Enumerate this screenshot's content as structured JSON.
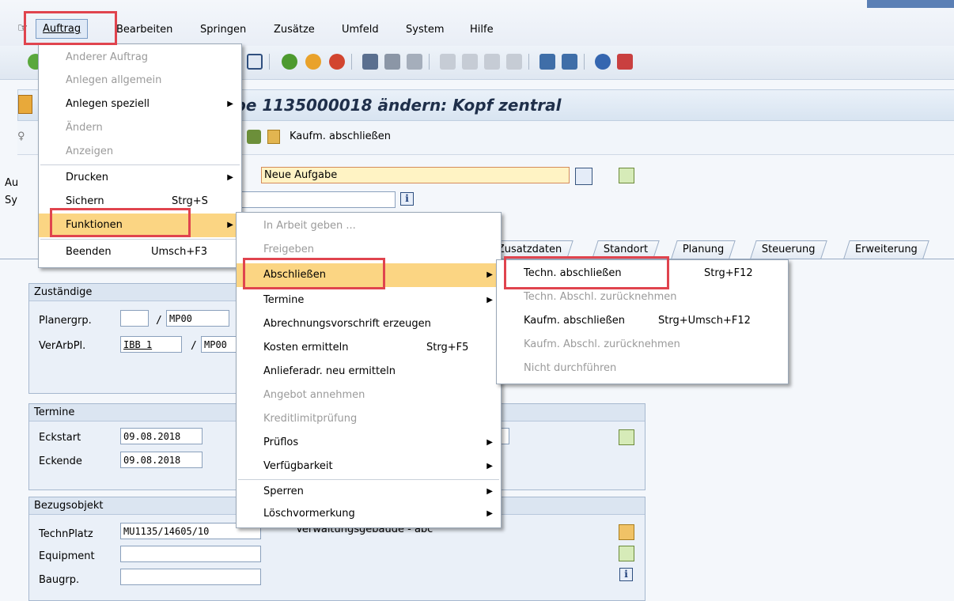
{
  "menubar": {
    "items": [
      "Auftrag",
      "Bearbeiten",
      "Springen",
      "Zusätze",
      "Umfeld",
      "System",
      "Hilfe"
    ]
  },
  "title": "abe 1135000018 ändern: Kopf zentral",
  "app_toolbar": {
    "kaufm_label": "Kaufm. abschließen"
  },
  "header_field": {
    "value": "Neue Aufgabe"
  },
  "tabs": [
    "Zusatzdaten",
    "Standort",
    "Planung",
    "Steuerung",
    "Erweiterung"
  ],
  "groups": {
    "zustaendige": {
      "title": "Zuständige",
      "planergrp_label": "Planergrp.",
      "planergrp_value": "MP00",
      "verarbpl_label": "VerArbPl.",
      "verarbpl_value": "IBB 1",
      "verarbpl_plant": "MP00"
    },
    "termine": {
      "title": "Termine",
      "eckstart_label": "Eckstart",
      "eckstart_value": "09.08.2018",
      "eckende_label": "Eckende",
      "eckende_value": "09.08.2018"
    },
    "bezugsobjekt": {
      "title": "Bezugsobjekt",
      "technplatz_label": "TechnPlatz",
      "technplatz_value": "MU1135/14605/10",
      "technplatz_desc": "Verwaltungsgebäude - abc",
      "equipment_label": "Equipment",
      "baugrp_label": "Baugrp."
    }
  },
  "left_labels": {
    "au": "Au",
    "sy": "Sy"
  },
  "menu_auftrag": [
    {
      "label": "Anderer Auftrag",
      "disabled": true
    },
    {
      "label": "Anlegen allgemein",
      "disabled": true
    },
    {
      "label": "Anlegen speziell",
      "submenu": true
    },
    {
      "label": "Ändern",
      "disabled": true
    },
    {
      "label": "Anzeigen",
      "disabled": true
    },
    {
      "label": "Drucken",
      "submenu": true
    },
    {
      "label": "Sichern",
      "shortcut": "Strg+S"
    },
    {
      "label": "Funktionen",
      "submenu": true,
      "highlighted": true
    },
    {
      "label": "Beenden",
      "shortcut": "Umsch+F3"
    }
  ],
  "menu_funktionen": [
    {
      "label": "In Arbeit geben ...",
      "disabled": true
    },
    {
      "label": "Freigeben",
      "disabled": true
    },
    {
      "label": "Abschließen",
      "submenu": true,
      "highlighted": true
    },
    {
      "label": "Termine",
      "submenu": true
    },
    {
      "label": "Abrechnungsvorschrift erzeugen"
    },
    {
      "label": "Kosten ermitteln",
      "shortcut": "Strg+F5"
    },
    {
      "label": "Anlieferadr. neu ermitteln"
    },
    {
      "label": "Angebot annehmen",
      "disabled": true
    },
    {
      "label": "Kreditlimitprüfung",
      "disabled": true
    },
    {
      "label": "Prüflos",
      "submenu": true
    },
    {
      "label": "Verfügbarkeit",
      "submenu": true
    },
    {
      "label": "Sperren",
      "submenu": true
    },
    {
      "label": "Löschvormerkung",
      "submenu": true
    }
  ],
  "menu_abschliessen": [
    {
      "label": "Techn. abschließen",
      "shortcut": "Strg+F12"
    },
    {
      "label": "Techn. Abschl. zurücknehmen",
      "disabled": true
    },
    {
      "label": "Kaufm. abschließen",
      "shortcut": "Strg+Umsch+F12"
    },
    {
      "label": "Kaufm. Abschl. zurücknehmen",
      "disabled": true
    },
    {
      "label": "Nicht durchführen",
      "disabled": true
    }
  ],
  "colors": {
    "highlight": "#fbd583",
    "annotation_red": "#e0444e"
  }
}
